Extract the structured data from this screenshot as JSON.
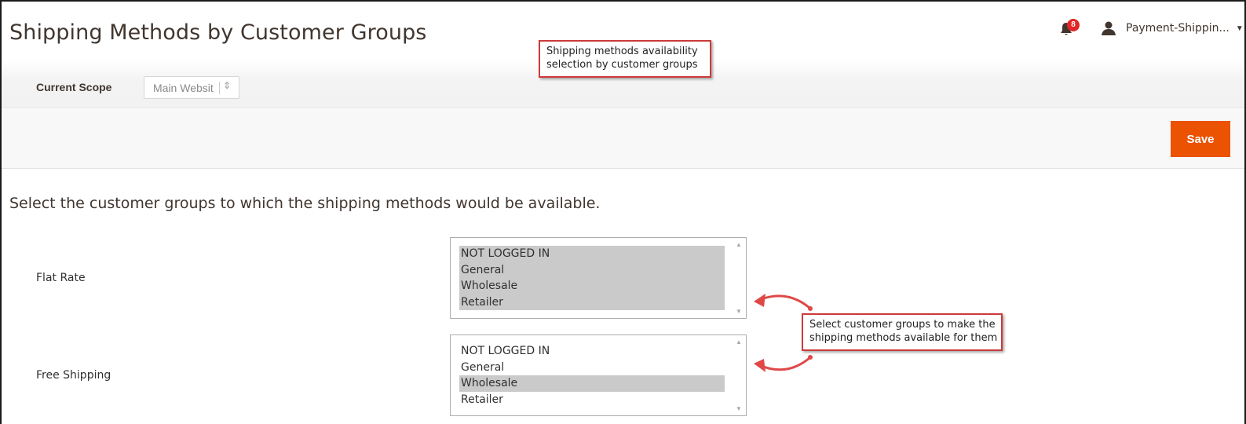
{
  "page": {
    "title": "Shipping Methods by Customer Groups"
  },
  "header": {
    "notifications": {
      "count": "8"
    },
    "user": {
      "name": "Payment-Shippin..."
    }
  },
  "scope": {
    "label": "Current Scope",
    "selected": "Main Websit"
  },
  "toolbar": {
    "save_label": "Save"
  },
  "content": {
    "intro": "Select the customer groups to which the shipping methods would be available.",
    "rows": [
      {
        "label": "Flat Rate",
        "options": [
          {
            "label": "NOT LOGGED IN",
            "selected": true
          },
          {
            "label": "General",
            "selected": true
          },
          {
            "label": "Wholesale",
            "selected": true
          },
          {
            "label": "Retailer",
            "selected": true
          }
        ]
      },
      {
        "label": "Free Shipping",
        "options": [
          {
            "label": "NOT LOGGED IN",
            "selected": false
          },
          {
            "label": "General",
            "selected": false
          },
          {
            "label": "Wholesale",
            "selected": true
          },
          {
            "label": "Retailer",
            "selected": false
          }
        ]
      }
    ]
  },
  "annotations": {
    "callout_top": [
      "Shipping methods availability",
      "selection by customer groups"
    ],
    "callout_right": [
      "Select customer groups to make the",
      "shipping methods available for them"
    ]
  },
  "colors": {
    "accent": "#eb5202",
    "badge": "#e22626",
    "callout_border": "#cc3a3a",
    "selected_option": "#cacaca"
  }
}
